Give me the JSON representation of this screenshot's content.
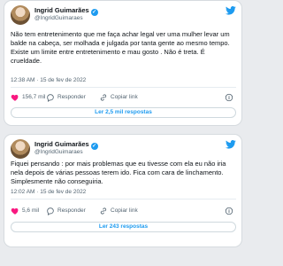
{
  "colors": {
    "accent": "#1d9bf0",
    "muted": "#536471",
    "background": "#e9ebee"
  },
  "tweets": [
    {
      "author_name": "Ingrid Guimarães",
      "handle": "@IngridGuimaraes",
      "verified_icon": "check-mark",
      "text": "Não tem entretenimento que me faça achar legal ver uma mulher levar um balde na cabeça, ser molhada e julgada por tanta gente ao mesmo tempo. Existe um limite entre entretenimento e mau gosto . Não é treta. É crueldade.",
      "time": "12:38 AM",
      "date": "15 de fev de 2022",
      "likes": "156,7 mil",
      "reply_label": "Responder",
      "copy_link_label": "Copiar link",
      "read_replies": "Ler 2,5 mil respostas"
    },
    {
      "author_name": "Ingrid Guimarães",
      "handle": "@IngridGuimaraes",
      "verified_icon": "check-mark",
      "text": "Fiquei pensando : por mais problemas que eu tivesse com ela eu não iria nela depois de várias pessoas terem ido. Fica com cara de linchamento. Simplesmente não conseguiria.",
      "time": "12:02 AM",
      "date": "15 de fev de 2022",
      "likes": "5,6 mil",
      "reply_label": "Responder",
      "copy_link_label": "Copiar link",
      "read_replies": "Ler 243 respostas"
    }
  ]
}
